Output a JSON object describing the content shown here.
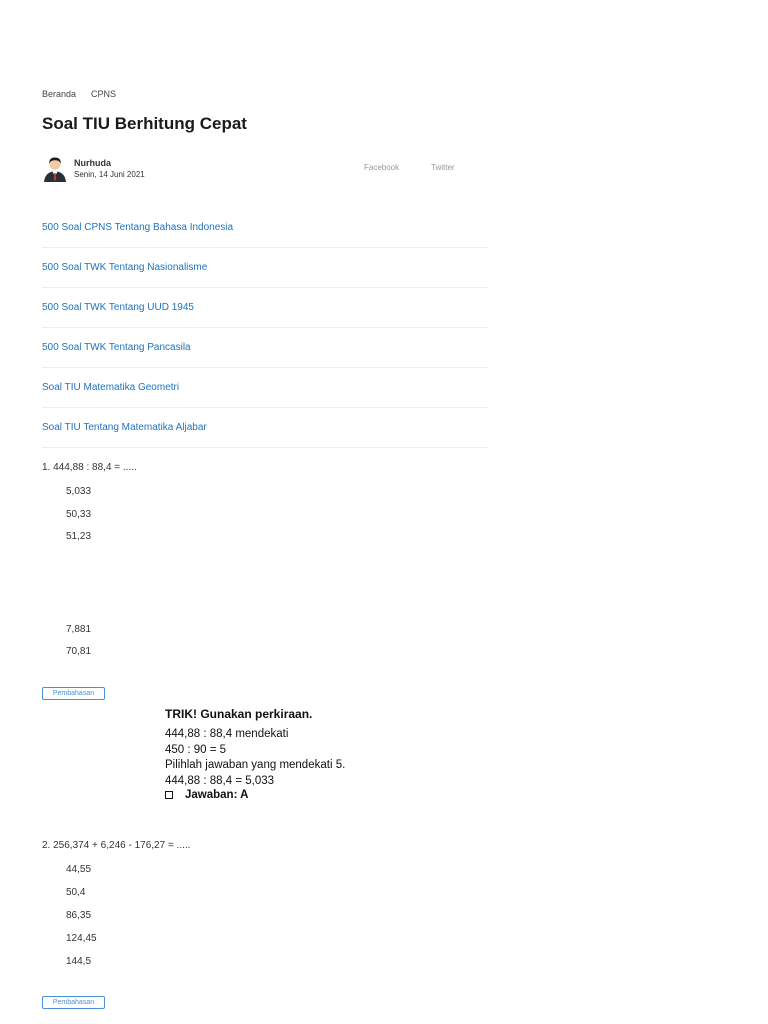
{
  "breadcrumb": [
    "Beranda",
    "CPNS"
  ],
  "title": "Soal TIU Berhitung Cepat",
  "author": {
    "name": "Nurhuda",
    "date": "Senin, 14 Juni 2021"
  },
  "share": {
    "facebook": "Facebook",
    "twitter": "Twitter"
  },
  "related_links": [
    "500 Soal CPNS Tentang Bahasa Indonesia",
    "500 Soal TWK Tentang Nasionalisme",
    "500 Soal TWK Tentang UUD 1945",
    "500 Soal TWK Tentang Pancasila",
    "Soal TIU Matematika Geometri",
    "Soal TIU Tentang Matematika Aljabar"
  ],
  "questions": [
    {
      "text": "1. 444,88 : 88,4 = .....",
      "options": [
        "5,033",
        "50,33",
        "51,23",
        "7,881",
        "70,81"
      ]
    },
    {
      "text": "2. 256,374 + 6,246 - 176,27 = .....",
      "options": [
        "44,55",
        "50,4",
        "86,35",
        "124,45",
        "144,5"
      ]
    }
  ],
  "pembahasan_label": "Pembahasan",
  "explanation": {
    "title": "TRIK! Gunakan perkiraan.",
    "lines": [
      "444,88 : 88,4 mendekati",
      "450 : 90 = 5",
      "Pilihlah jawaban yang mendekati 5.",
      "444,88 : 88,4 = 5,033"
    ],
    "answer": "Jawaban: A"
  }
}
